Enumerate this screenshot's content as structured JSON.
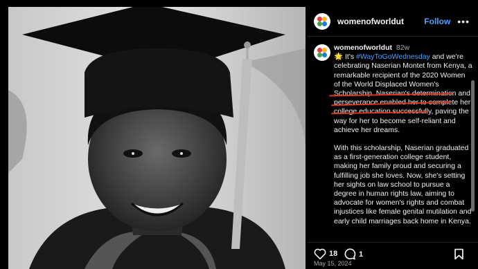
{
  "post": {
    "username": "womenofworldut",
    "follow_label": "Follow",
    "more_label": "•••",
    "caption_user": "womenofworldut",
    "caption_time": "82w",
    "caption_emoji": "🌟",
    "caption_pre": " It's ",
    "hashtag": "#WayToGoWednesday",
    "caption_p1": " and we're celebrating Naserian Montet from Kenya, a remarkable recipient of the 2020 Women of the World Displaced Women's Scholarship. Naserian's determination and perseverance enabled her to complete her college education successfully, paving the way for her to become self-reliant and achieve her dreams.",
    "caption_p2": "With this scholarship, Naserian graduated as a first-generation college student, making her family proud and securing a fulfilling job she loves. Now, she's setting her sights on law school to pursue a degree in human rights law, aiming to advocate for women's rights and combat injustices like female genital mutilation and early child marriages back home in Kenya.",
    "likes": "18",
    "comments": "1",
    "date": "May 15, 2024"
  },
  "icons": {
    "heart": "heart-icon",
    "comment": "comment-icon",
    "bookmark": "bookmark-icon",
    "avatar_logo": "logo-icon"
  },
  "colors": {
    "accent": "#4aa0ff",
    "annotation": "#e0321e",
    "background": "#000000"
  }
}
